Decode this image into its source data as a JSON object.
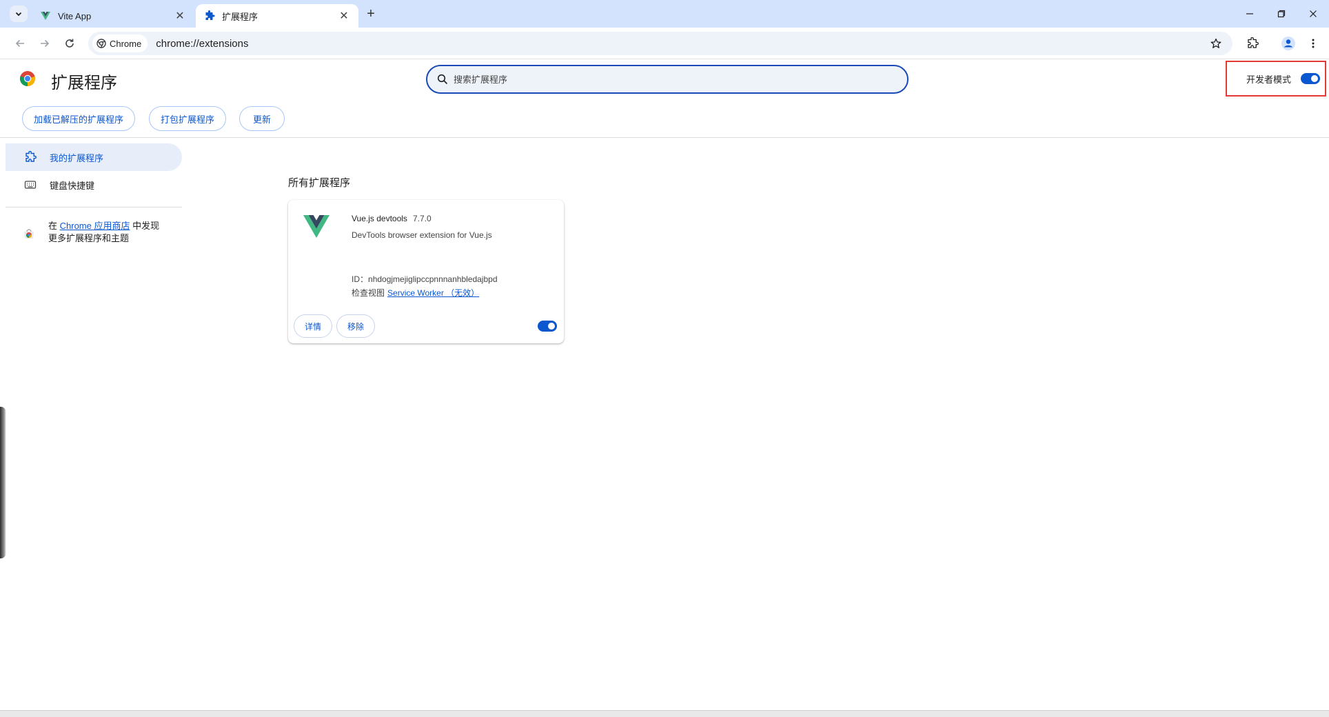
{
  "browser": {
    "tabs": [
      {
        "title": "Vite App",
        "active": false
      },
      {
        "title": "扩展程序",
        "active": true
      }
    ],
    "omnibox": {
      "chip_label": "Chrome",
      "url": "chrome://extensions"
    }
  },
  "extensions_page": {
    "title": "扩展程序",
    "search_placeholder": "搜索扩展程序",
    "developer_mode": {
      "label": "开发者模式",
      "enabled": true
    },
    "actions": {
      "load_unpacked": "加载已解压的扩展程序",
      "pack": "打包扩展程序",
      "update": "更新"
    }
  },
  "sidebar": {
    "items": [
      {
        "label": "我的扩展程序",
        "selected": true,
        "icon": "extension-puzzle-icon"
      },
      {
        "label": "键盘快捷键",
        "selected": false,
        "icon": "keyboard-icon"
      }
    ],
    "webstore": {
      "prefix": "在 ",
      "link": "Chrome 应用商店",
      "suffix_line1": " 中发现",
      "line2": "更多扩展程序和主题"
    }
  },
  "main": {
    "section_title": "所有扩展程序",
    "extensions": [
      {
        "name": "Vue.js devtools",
        "version": "7.7.0",
        "description": "DevTools browser extension for Vue.js",
        "id_label": "ID：",
        "id": "nhdogjmejiglipccpnnnanhbledajbpd",
        "inspect_label": "检查视图",
        "inspect_link": "Service Worker （无效）",
        "details_button": "详情",
        "remove_button": "移除",
        "enabled": true
      }
    ]
  },
  "colors": {
    "accent": "#0b57d0",
    "tabstrip": "#d3e3fd",
    "highlight_box": "#e53935",
    "vue_green": "#41b883",
    "vue_dark": "#34495e"
  }
}
